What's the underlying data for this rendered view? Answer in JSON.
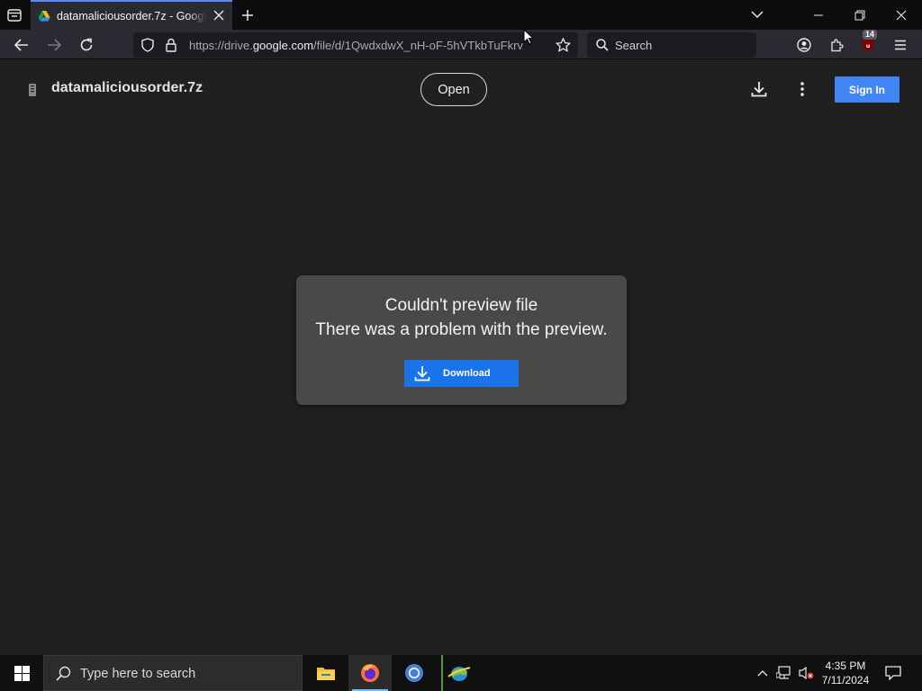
{
  "browser": {
    "tab": {
      "title": "datamaliciousorder.7z - Google Drive"
    },
    "url": {
      "prefix": "https://drive.",
      "domain": "google.com",
      "path": "/file/d/1QwdxdwX_nH-oF-5hVTkbTuFkrv"
    },
    "search": {
      "placeholder": "Search"
    },
    "extension_badge": "14"
  },
  "drive": {
    "file_name": "datamaliciousorder.7z",
    "open_label": "Open",
    "signin_label": "Sign In",
    "error_title": "Couldn't preview file",
    "error_message": "There was a problem with the preview.",
    "download_label": "Download",
    "accent": "#1a73e8"
  },
  "taskbar": {
    "search_placeholder": "Type here to search",
    "time": "4:35 PM",
    "date": "7/11/2024"
  }
}
